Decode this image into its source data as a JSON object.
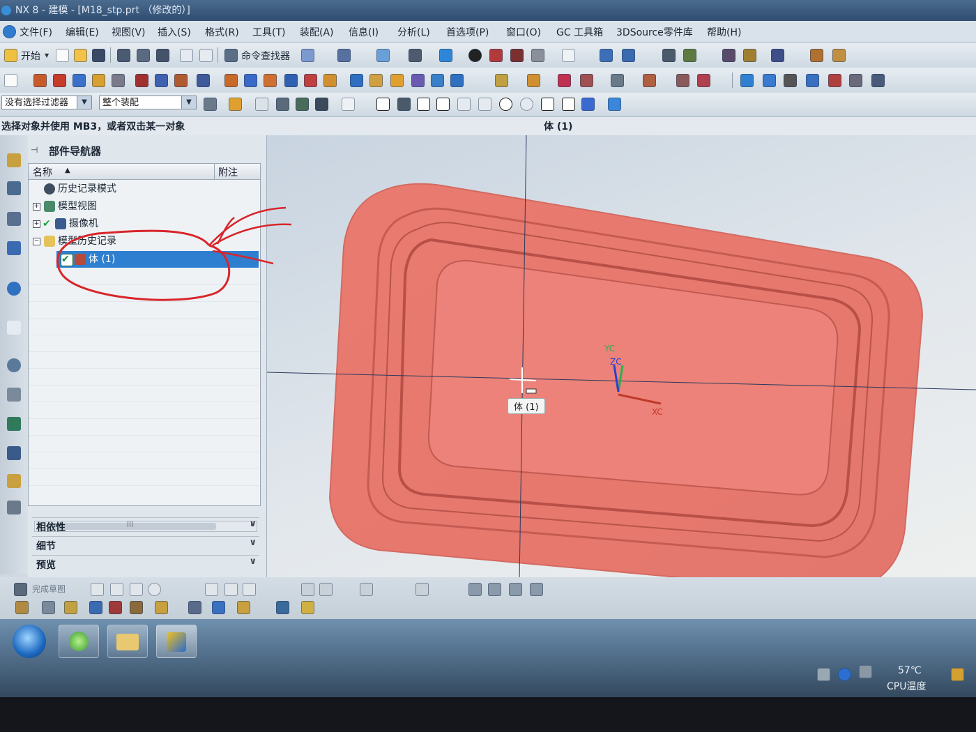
{
  "window": {
    "title": "NX 8 - 建模 - [M18_stp.prt （修改的）]"
  },
  "menu": [
    "文件(F)",
    "编辑(E)",
    "视图(V)",
    "插入(S)",
    "格式(R)",
    "工具(T)",
    "装配(A)",
    "信息(I)",
    "分析(L)",
    "首选项(P)",
    "窗口(O)",
    "GC 工具箱",
    "3DSource零件库",
    "帮助(H)"
  ],
  "toolbar": {
    "start_label": "开始",
    "command_finder_label": "命令查找器"
  },
  "selection_bar": {
    "filter": "没有选择过滤器",
    "scope": "整个装配"
  },
  "status": {
    "prompt": "选择对象并使用 MB3，或者双击某一对象",
    "selection": "体 (1)"
  },
  "navigator": {
    "title": "部件导航器",
    "columns": {
      "name": "名称",
      "notes": "附注"
    },
    "nodes": [
      {
        "label": "历史记录模式",
        "icon": "clock-icon"
      },
      {
        "label": "模型视图",
        "icon": "model-views-icon"
      },
      {
        "label": "摄像机",
        "icon": "camera-icon"
      },
      {
        "label": "模型历史记录",
        "icon": "folder-icon"
      },
      {
        "label": "体 (1)",
        "icon": "body-icon"
      }
    ],
    "panels": [
      "相依性",
      "细节",
      "预览"
    ],
    "panel_toggle": "∨",
    "scroll_thumb": "|||"
  },
  "viewport": {
    "tooltip": "体 (1)",
    "axes": {
      "x": "XC",
      "y": "YC",
      "z": "ZC"
    },
    "model_color": "#e9786e"
  },
  "bottom_toolbar": {
    "sketch_label": "完成草图"
  },
  "tray": {
    "temperature": "57℃",
    "temp_label": "CPU温度"
  },
  "annotation": {
    "color": "#d8252a"
  }
}
